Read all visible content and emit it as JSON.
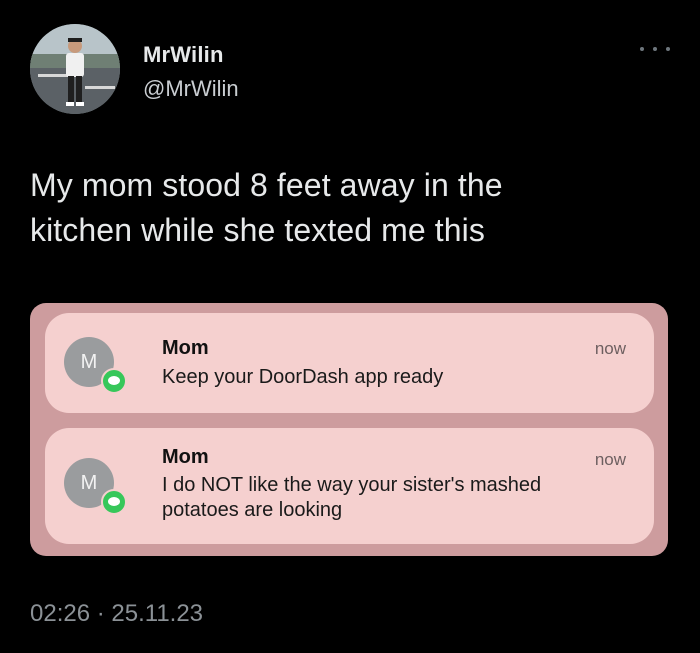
{
  "author": {
    "display_name": "MrWilin",
    "handle": "@MrWilin"
  },
  "tweet": {
    "text": "My mom stood 8 feet away in the\nkitchen while she texted me this"
  },
  "notifications": [
    {
      "avatar_initial": "M",
      "sender": "Mom",
      "message": "Keep your DoorDash app ready",
      "time": "now"
    },
    {
      "avatar_initial": "M",
      "sender": "Mom",
      "message": "I do NOT like the way your sister's mashed potatoes are looking",
      "time": "now"
    }
  ],
  "meta": {
    "timestamp": "02:26 · 25.11.23"
  },
  "colors": {
    "background": "#000000",
    "media_frame": "#cd9c9e",
    "notification_card": "#f5d0cf",
    "messages_badge": "#37c75a"
  },
  "icons": {
    "more": "more-horizontal-icon",
    "badge": "messages-app-icon"
  }
}
